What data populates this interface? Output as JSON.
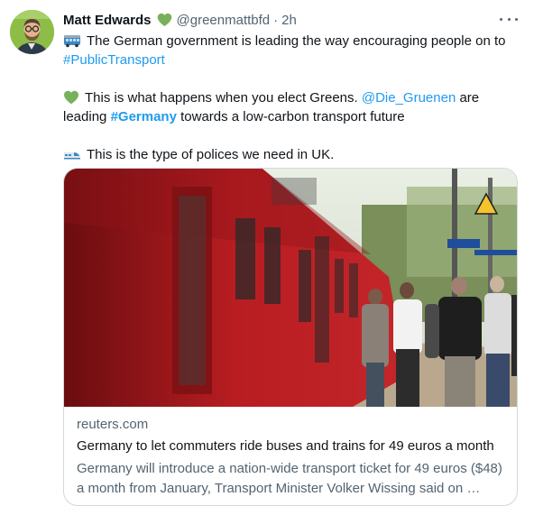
{
  "author": {
    "name": "Matt Edwards",
    "handle": "@greenmattbfd",
    "separator": "·",
    "time": "2h"
  },
  "tweet": {
    "line1": "The German government is leading the way encouraging people on to",
    "hashtag1": "#PublicTransport",
    "line2_prefix": "This is what happens when you elect Greens.",
    "mention": "@Die_Gruenen",
    "line2_suffix": "are",
    "line3_prefix": "leading",
    "hashtag2": "#Germany",
    "line3_suffix": "towards a low-carbon transport future",
    "line4": "This is the type of polices we need in UK."
  },
  "card": {
    "domain": "reuters.com",
    "title": "Germany to let commuters ride buses and trains for 49 euros a month",
    "desc_line1": "Germany will introduce a nation-wide transport ticket for 49 euros ($48)",
    "desc_line2": "a month from January, Transport Minister Volker Wissing said on …"
  },
  "icons": {
    "verified_heart": "green-heart-icon",
    "bus": "bus-icon",
    "heart": "green-heart-icon",
    "train": "high-speed-train-icon",
    "more": "more-icon"
  },
  "colors": {
    "link": "#1d9bf0",
    "text": "#0f1419",
    "secondary": "#536471",
    "heart": "#78b159",
    "border": "#cfd9de"
  }
}
